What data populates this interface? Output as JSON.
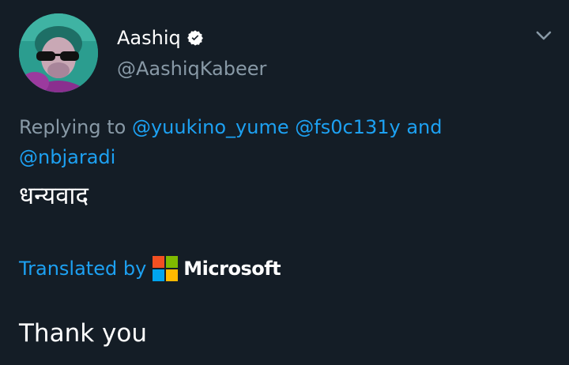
{
  "author": {
    "name": "Aashiq",
    "handle": "@AashiqKabeer",
    "avatar_icon": "user-avatar"
  },
  "reply": {
    "prefix": "Replying to",
    "mentions": [
      "@yuukino_yume",
      "@fs0c131y",
      "@nbjaradi"
    ],
    "conjunction": "and"
  },
  "tweet": {
    "text": "धन्यवाद"
  },
  "translation": {
    "label": "Translated by",
    "provider": "Microsoft",
    "text": "Thank you"
  },
  "icons": {
    "verified": "verified-badge-icon",
    "menu": "chevron-down-icon",
    "provider_logo": "microsoft-logo-icon"
  },
  "colors": {
    "background": "#141d26",
    "link": "#1da1f2",
    "muted": "#8899a6",
    "text": "#ffffff"
  }
}
